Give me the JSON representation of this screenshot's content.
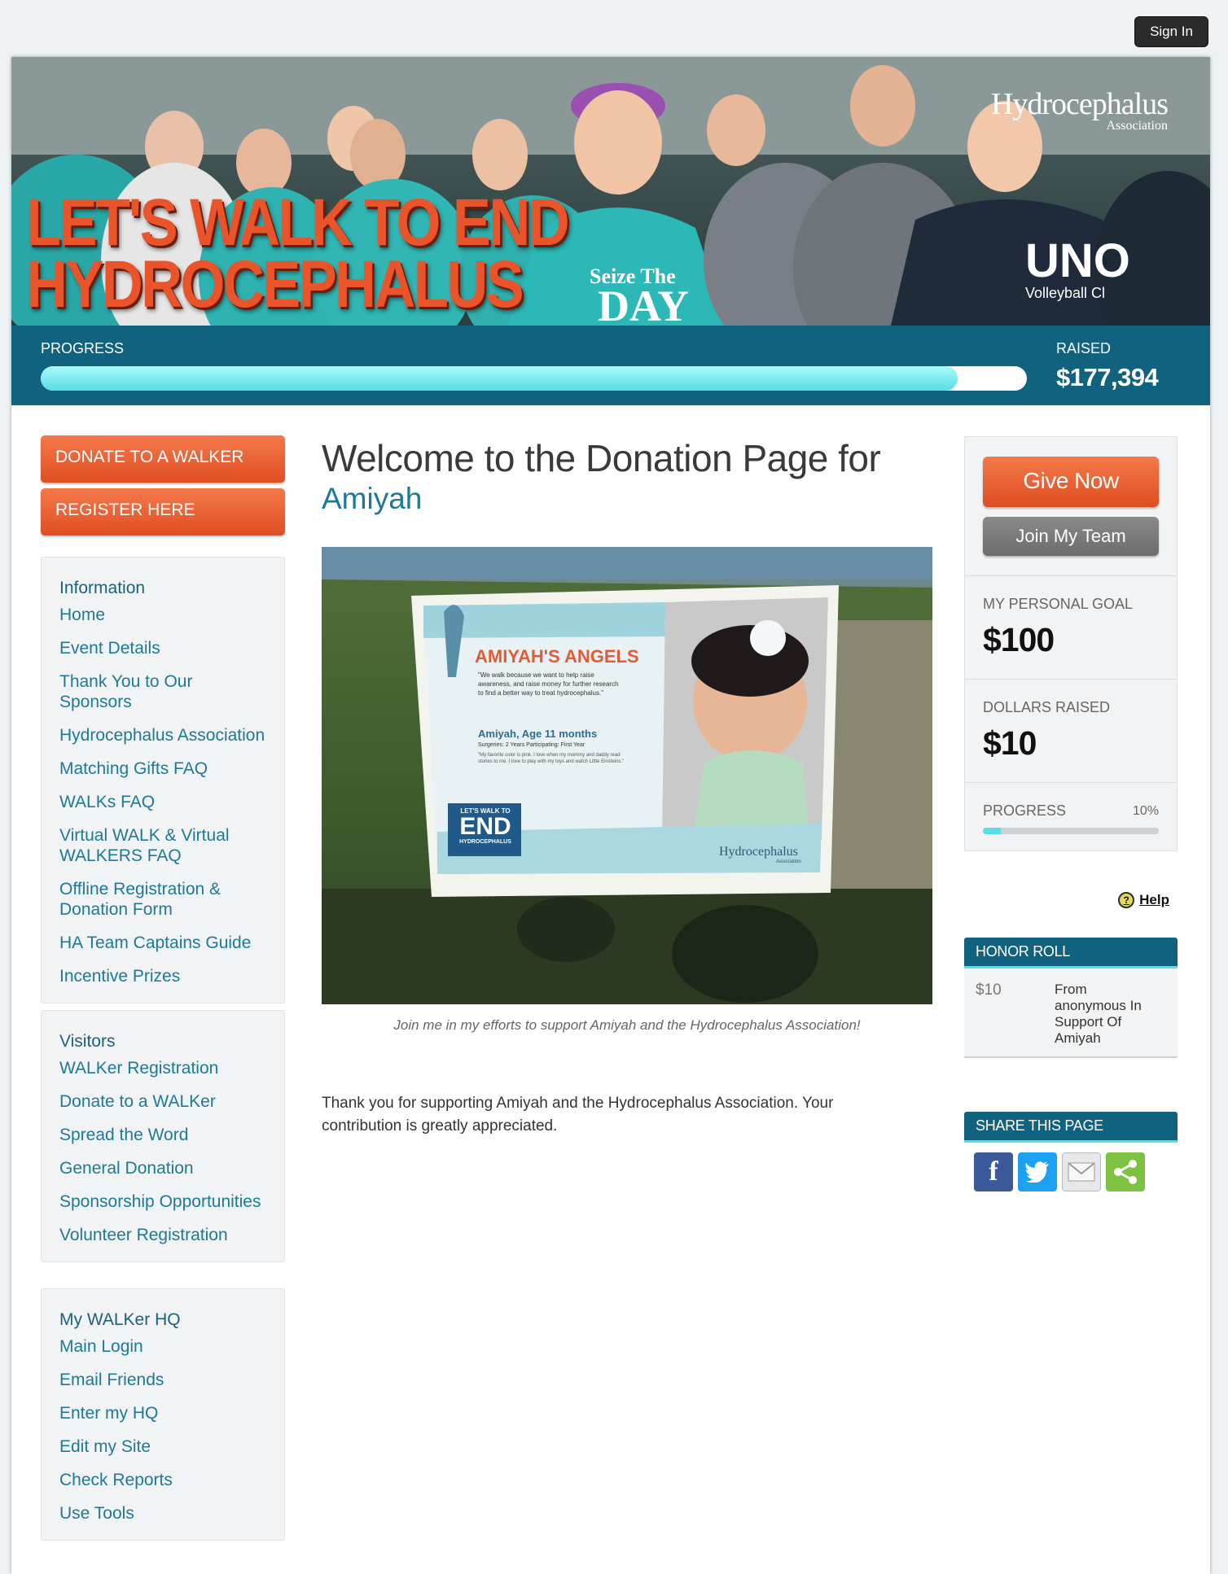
{
  "header": {
    "sign_in": "Sign In"
  },
  "banner": {
    "title_line1": "LET'S WALK TO END",
    "title_line2": "HYDROCEPHALUS",
    "logo_name": "Hydrocephalus",
    "logo_sub": "Association"
  },
  "campaign": {
    "progress_label": "PROGRESS",
    "progress_fraction": 0.93,
    "raised_label": "RAISED",
    "raised_value": "$177,394"
  },
  "sidebar": {
    "cta_donate": "DONATE TO A WALKER",
    "cta_register": "REGISTER HERE",
    "sections": [
      {
        "heading": "Information",
        "links": [
          "Home",
          "Event Details",
          "Thank You to Our Sponsors",
          "Hydrocephalus Association",
          "Matching Gifts FAQ",
          "WALKs FAQ",
          "Virtual WALK & Virtual WALKERS FAQ",
          "Offline Registration & Donation Form",
          "HA Team Captains Guide",
          "Incentive Prizes"
        ]
      },
      {
        "heading": "Visitors",
        "links": [
          "WALKer Registration",
          "Donate to a WALKer",
          "Spread the Word",
          "General Donation",
          "Sponsorship Opportunities",
          "Volunteer Registration"
        ]
      },
      {
        "heading": "My WALKer HQ",
        "links": [
          "Main Login",
          "Email Friends",
          "Enter my HQ",
          "Edit my Site",
          "Check Reports",
          "Use Tools"
        ]
      }
    ]
  },
  "main": {
    "welcome": "Welcome to the Donation Page for",
    "name": "Amiyah",
    "photo": {
      "sign_title": "AMIYAH'S ANGELS",
      "sign_quote": "\"We walk because we want to help raise awareness, and raise money for further research to find a better way to treat hydrocephalus.\"",
      "sign_name": "Amiyah, Age 11 months",
      "sign_meta": "Surgeries: 2     Years Participating: First Year",
      "sign_favorite": "\"My favorite color is pink. I love when my mommy and daddy read stories to me. I love to play with my toys and watch Little Einsteins.\"",
      "sign_badge_top": "LET'S WALK TO",
      "sign_badge_big": "END",
      "sign_badge_bottom": "HYDROCEPHALUS",
      "sign_logo": "Hydrocephalus",
      "sign_logo_sub": "Association"
    },
    "caption": "Join me in my efforts to support Amiyah and the Hydrocephalus Association!",
    "thanks": "Thank you for supporting Amiyah and the Hydrocephalus Association. Your contribution is greatly appreciated."
  },
  "right": {
    "give_now": "Give Now",
    "join_team": "Join My Team",
    "goal_label": "MY PERSONAL GOAL",
    "goal_value": "$100",
    "raised_label": "DOLLARS RAISED",
    "raised_value": "$10",
    "progress_label": "PROGRESS",
    "progress_pct": "10%",
    "progress_fraction": 0.1,
    "help": "Help",
    "honor_head": "HONOR ROLL",
    "honor_amount": "$10",
    "honor_text": "From anonymous In Support Of Amiyah",
    "share_head": "SHARE THIS PAGE",
    "share_icons": [
      "facebook-icon",
      "twitter-icon",
      "email-icon",
      "share-icon"
    ]
  },
  "colors": {
    "brand_teal": "#10627e",
    "accent_orange": "#e9542b",
    "progress_aqua": "#58dde6"
  }
}
